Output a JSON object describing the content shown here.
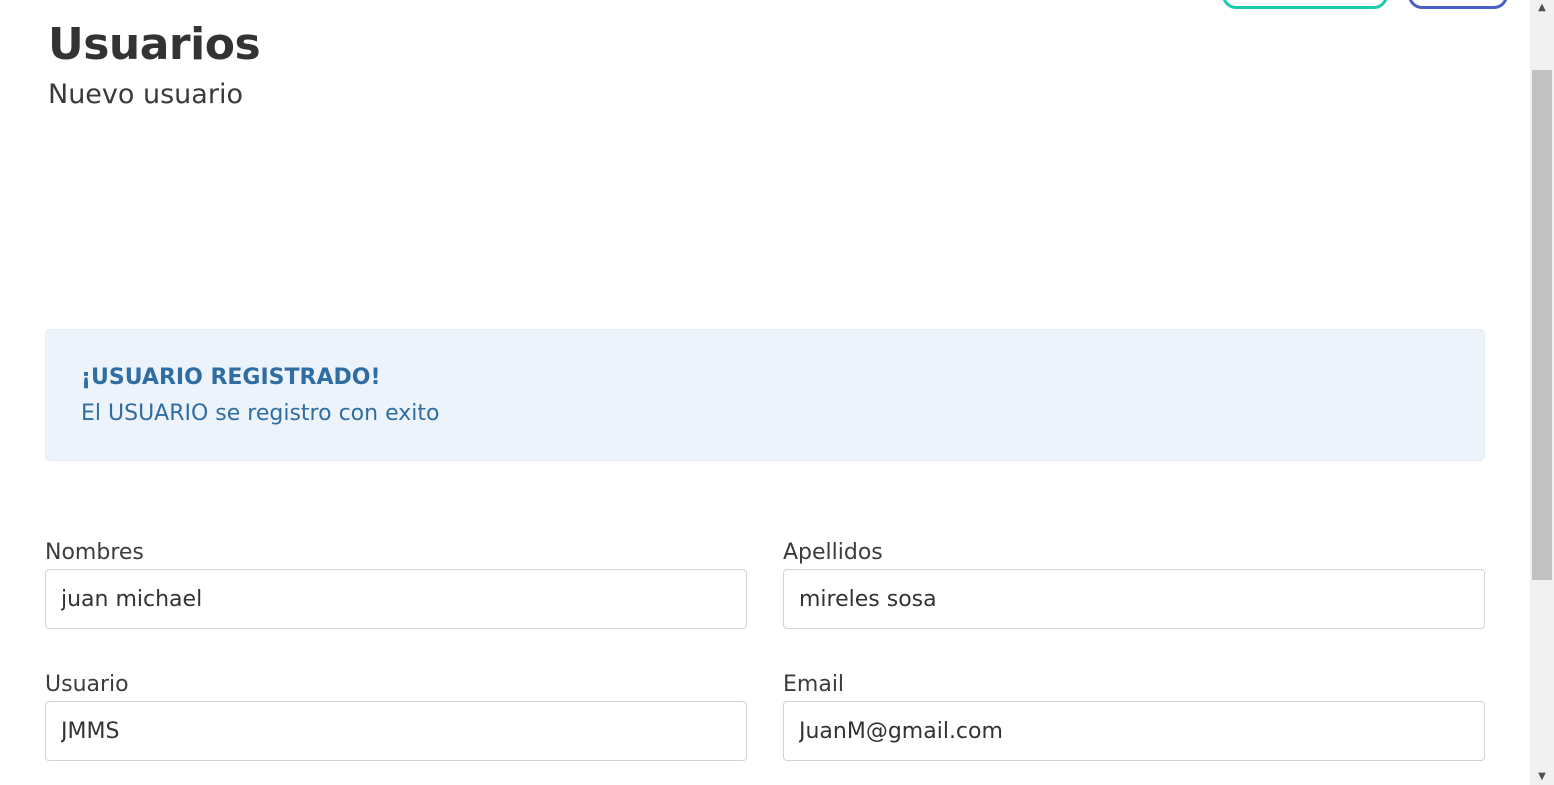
{
  "header": {
    "title": "Usuarios",
    "subtitle": "Nuevo usuario"
  },
  "alert": {
    "title": "¡USUARIO REGISTRADO!",
    "message": "El USUARIO se registro con exito",
    "color": "#2f6da3",
    "background": "#edf3fb"
  },
  "form": {
    "nombres": {
      "label": "Nombres",
      "value": "juan michael"
    },
    "apellidos": {
      "label": "Apellidos",
      "value": "mireles sosa"
    },
    "usuario": {
      "label": "Usuario",
      "value": "JMMS"
    },
    "email": {
      "label": "Email",
      "value": "JuanM@gmail.com"
    }
  },
  "top_buttons": {
    "teal_color": "#1ac9ae",
    "blue_color": "#4a5fc8"
  },
  "scrollbar": {
    "up_icon": "▲",
    "down_icon": "▼"
  }
}
